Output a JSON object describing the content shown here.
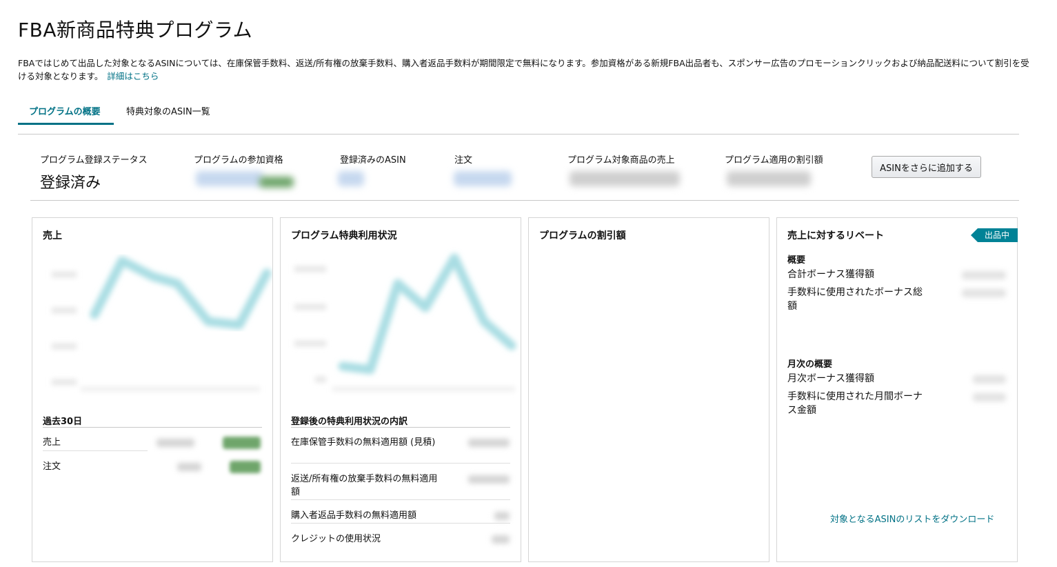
{
  "page": {
    "title": "FBA新商品特典プログラム",
    "intro": "FBAではじめて出品した対象となるASINについては、在庫保管手数料、返送/所有権の放棄手数料、購入者返品手数料が期間限定で無料になります。参加資格がある新規FBA出品者も、スポンサー広告のプロモーションクリックおよび納品配送料について割引を受ける対象となります。",
    "intro_link": "詳細はこちら"
  },
  "tabs": [
    {
      "label": "プログラムの概要",
      "active": true
    },
    {
      "label": "特典対象のASIN一覧",
      "active": false
    }
  ],
  "stats": {
    "status_label": "プログラム登録ステータス",
    "status_value": "登録済み",
    "eligibility_label": "プログラムの参加資格",
    "asin_label": "登録済みのASIN",
    "orders_label": "注文",
    "sales_label": "プログラム対象商品の売上",
    "discount_label": "プログラム適用の割引額",
    "add_button": "ASINをさらに追加する"
  },
  "cards": {
    "sales": {
      "title": "売上",
      "section": "過去30日",
      "rows": [
        {
          "label": "売上"
        },
        {
          "label": "注文"
        }
      ]
    },
    "usage": {
      "title": "プログラム特典利用状況",
      "section": "登録後の特典利用状況の内訳",
      "rows": [
        {
          "label": "在庫保管手数料の無料適用額 (見積)"
        },
        {
          "label": "返送/所有権の放棄手数料の無料適用額"
        },
        {
          "label": "購入者返品手数料の無料適用額"
        },
        {
          "label": "クレジットの使用状況"
        }
      ]
    },
    "discount": {
      "title": "プログラムの割引額"
    },
    "rebate": {
      "title": "売上に対するリベート",
      "badge": "出品中",
      "summary_head": "概要",
      "total_bonus": "合計ボーナス獲得額",
      "fee_bonus": "手数料に使用されたボーナス総額",
      "monthly_head": "月次の概要",
      "monthly_bonus": "月次ボーナス獲得額",
      "monthly_fee_bonus": "手数料に使用された月間ボーナス金額",
      "download": "対象となるASINのリストをダウンロード"
    }
  },
  "colors": {
    "accent": "#007185",
    "badge": "#008296",
    "chart_line": "#a9dde3"
  }
}
